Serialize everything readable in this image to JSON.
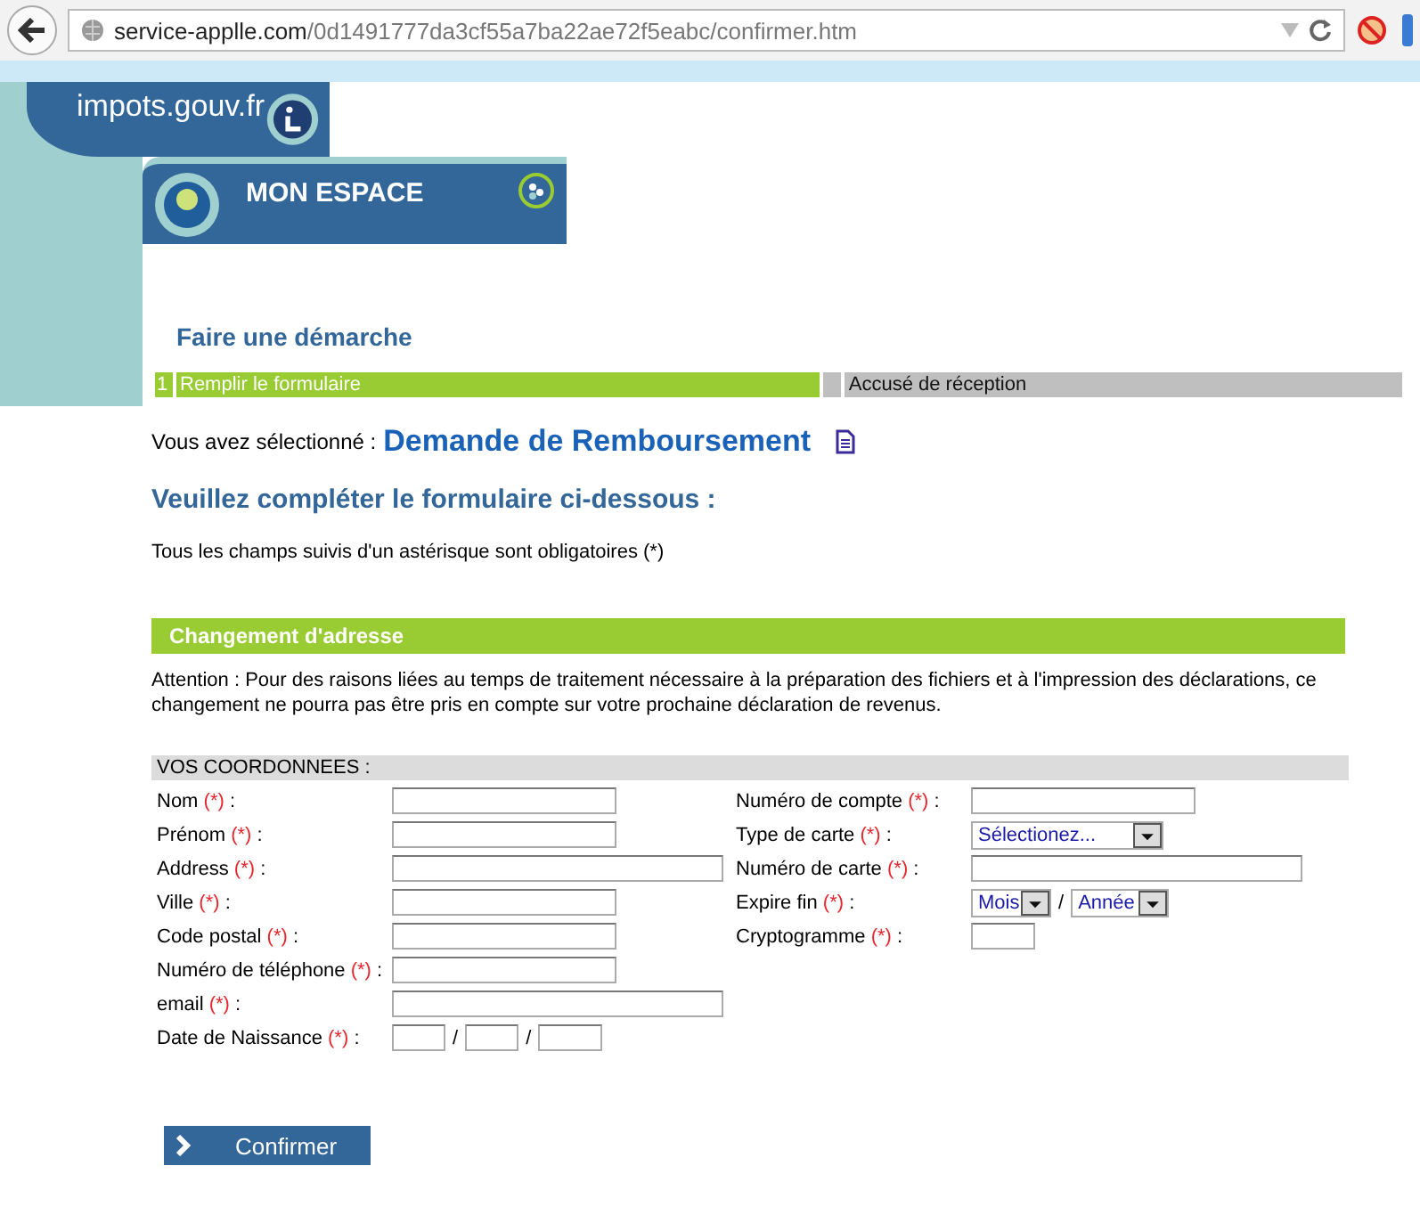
{
  "browser": {
    "url_domain": "service-applle.com",
    "url_path": "/0d1491777da3cf55a7ba22ae72f5eabc/confirmer.htm"
  },
  "header": {
    "site_logo": "impots.gouv.fr",
    "space_title": "MON ESPACE"
  },
  "page_title": "Faire une démarche",
  "steps": [
    {
      "number": "1",
      "label": "Remplir le formulaire",
      "selected": true
    },
    {
      "label": "Accusé de réception",
      "selected": false
    }
  ],
  "selection": {
    "prefix": "Vous avez sélectionné :",
    "title": "Demande de Remboursement"
  },
  "form_heading": "Veuillez compléter le formulaire ci-dessous  :",
  "required_note": "Tous les champs suivis d'un astérisque sont obligatoires (*)",
  "section": {
    "title": "Changement d'adresse",
    "notice": "Attention : Pour des raisons liées au temps de traitement nécessaire à la préparation des fichiers et à l'impression des déclarations, ce changement ne pourra pas être pris en compte sur votre prochaine déclaration de revenus."
  },
  "coordinates": {
    "title": "VOS COORDONNEES :",
    "left_fields": [
      {
        "label": "Nom",
        "mark": "(*)",
        "colon": ":",
        "kind": "short"
      },
      {
        "label": "Prénom",
        "mark": "(*)",
        "colon": ":",
        "kind": "short"
      },
      {
        "label": "Address",
        "mark": "(*)",
        "colon": ":",
        "kind": "long"
      },
      {
        "label": "Ville",
        "mark": "(*)",
        "colon": ":",
        "kind": "short"
      },
      {
        "label": "Code postal",
        "mark": "(*)",
        "colon": ":",
        "kind": "short"
      },
      {
        "label": "Numéro de téléphone",
        "mark": "(*)",
        "colon": ":",
        "kind": "short"
      },
      {
        "label": "email",
        "mark": "(*)",
        "colon": ":",
        "kind": "long"
      },
      {
        "label": "Date de Naissance",
        "mark": "(*)",
        "colon": ":",
        "kind": "date",
        "separators": [
          "/",
          "/"
        ]
      }
    ],
    "right_fields": [
      {
        "label": "Numéro de compte",
        "mark": "(*)",
        "colon": ":",
        "kind": "short"
      },
      {
        "label": "Type de carte",
        "mark": "(*)",
        "colon": ":",
        "kind": "select",
        "options": [
          "Sélectionez..."
        ]
      },
      {
        "label": "Numéro de carte",
        "mark": "(*)",
        "colon": ":",
        "kind": "long"
      },
      {
        "label": "Expire fin",
        "mark": "(*)",
        "colon": ":",
        "kind": "expiry",
        "options": [
          "Mois",
          "Année"
        ],
        "separators": [
          "/"
        ]
      },
      {
        "label": "Cryptogramme",
        "mark": "(*)",
        "colon": ":",
        "kind": "tiny"
      }
    ]
  },
  "submit": "Confirmer"
}
